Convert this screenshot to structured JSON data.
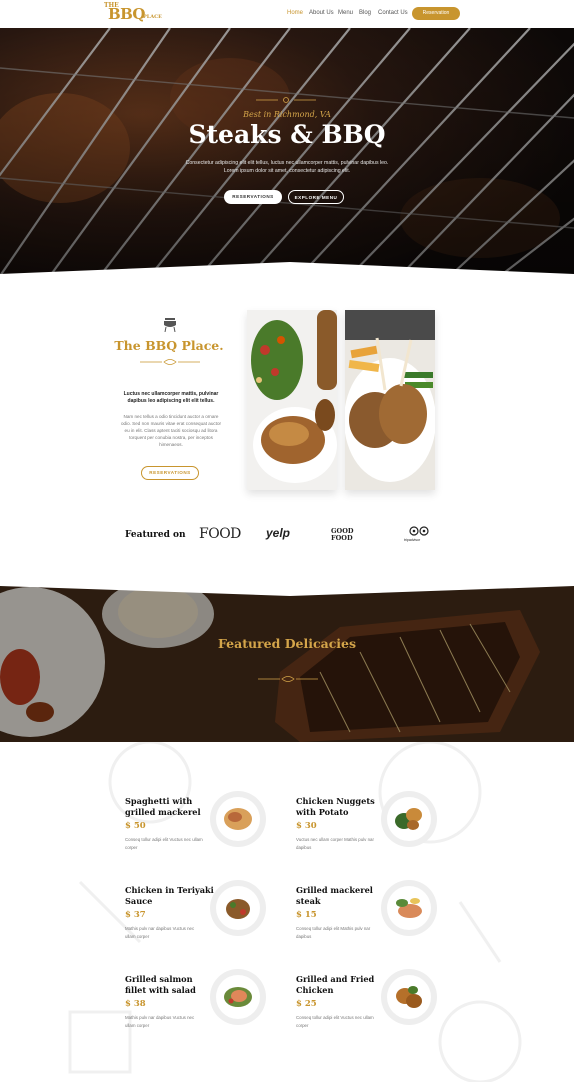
{
  "nav": {
    "logo": {
      "the": "THE",
      "bbq": "BBQ",
      "place": "PLACE"
    },
    "links": [
      "Home",
      "About Us",
      "Menu",
      "Blog",
      "Contact Us"
    ],
    "reservation_label": "Reservation"
  },
  "hero": {
    "kicker": "Best in Richmond, VA",
    "title": "Steaks & BBQ",
    "subtitle": "Consectetur adipiscing elit elit tellus, luctus nec ullamcorper mattis, pulvinar dapibus leo. Lorem ipsum dolor sit amet, consectetur adipiscing elit.",
    "btn_reservations": "RESERVATIONS",
    "btn_explore": "EXPLORE MENU"
  },
  "about": {
    "title": "The BBQ Place.",
    "lead": "Luctus nec ullamcorper mattis, pulvinar dapibus leo adipiscing elit elit tellus.",
    "body": "Nam nec tellus a odio tincidunt auctor a ornare odio. Sed non mauris vitae erat consequat auctor eu in elit. Class aptent taciti sociosqu ad litora torquent per conubia nostra, per inceptos himenaeos.",
    "btn": "RESERVATIONS"
  },
  "featured_on": {
    "label": "Featured on",
    "brands": [
      "FOOD",
      "yelp",
      "GOOD FOOD",
      "tripadvisor"
    ]
  },
  "delicacies": {
    "title": "Featured Delicacies"
  },
  "menu": [
    {
      "name": "Spaghetti with grilled mackerel",
      "price": "$ 50",
      "desc": "Conseq tollur adipi elit Vuctus nec ullam corper"
    },
    {
      "name": "Chicken Nuggets with Potato",
      "price": "$ 30",
      "desc": "Vuctus nec ullam corper Mathis pulv nar dapibus"
    },
    {
      "name": "Chicken in Teriyaki Sauce",
      "price": "$ 37",
      "desc": "Mathis pulv nar dapibus Vuctus nec ullam corper"
    },
    {
      "name": "Grilled mackerel steak",
      "price": "$ 15",
      "desc": "Conseq tollur adipi elit Mathis pulv nar dapibus"
    },
    {
      "name": "Grilled salmon fillet with salad",
      "price": "$ 38",
      "desc": "Mathis pulv nar dapibus Vuctus nec ullam corper"
    },
    {
      "name": "Grilled and Fried Chicken",
      "price": "$ 25",
      "desc": "Conseq tollur adipi elit Vuctus nec ullam corper"
    }
  ],
  "colors": {
    "accent": "#c8952e",
    "dark": "#1a1210"
  }
}
